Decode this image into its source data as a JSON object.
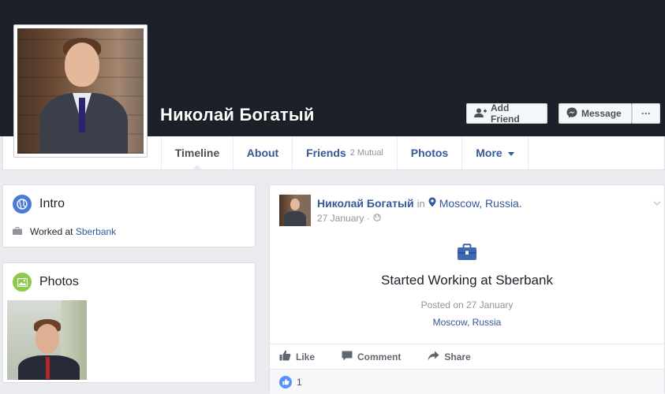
{
  "profile": {
    "name": "Николай Богатый",
    "buttons": {
      "add_friend": "Add Friend",
      "message": "Message",
      "more": "···"
    }
  },
  "nav": {
    "tabs": [
      {
        "label": "Timeline",
        "active": true
      },
      {
        "label": "About"
      },
      {
        "label": "Friends",
        "badge": "2 Mutual"
      },
      {
        "label": "Photos"
      },
      {
        "label": "More"
      }
    ]
  },
  "intro": {
    "title": "Intro",
    "work_prefix": "Worked at",
    "work_company": "Sberbank"
  },
  "photos": {
    "title": "Photos"
  },
  "post": {
    "author": "Николай Богатый",
    "in_word": "in",
    "location": "Moscow, Russia.",
    "date": "27 January ·",
    "event_title": "Started Working at Sberbank",
    "event_date": "Posted on 27 January",
    "event_place": "Moscow, Russia",
    "actions": {
      "like": "Like",
      "comment": "Comment",
      "share": "Share"
    },
    "like_count": "1"
  },
  "colors": {
    "cover": "#1d2029",
    "link": "#365899",
    "page_bg": "#e9ebee",
    "like_blue": "#5890ff"
  },
  "icons": [
    "globe-icon",
    "photo-icon",
    "briefcase-icon",
    "map-pin-icon",
    "public-globe-icon",
    "like-icon",
    "comment-icon",
    "share-icon",
    "add-friend-icon",
    "messenger-icon",
    "chevron-down-icon"
  ]
}
